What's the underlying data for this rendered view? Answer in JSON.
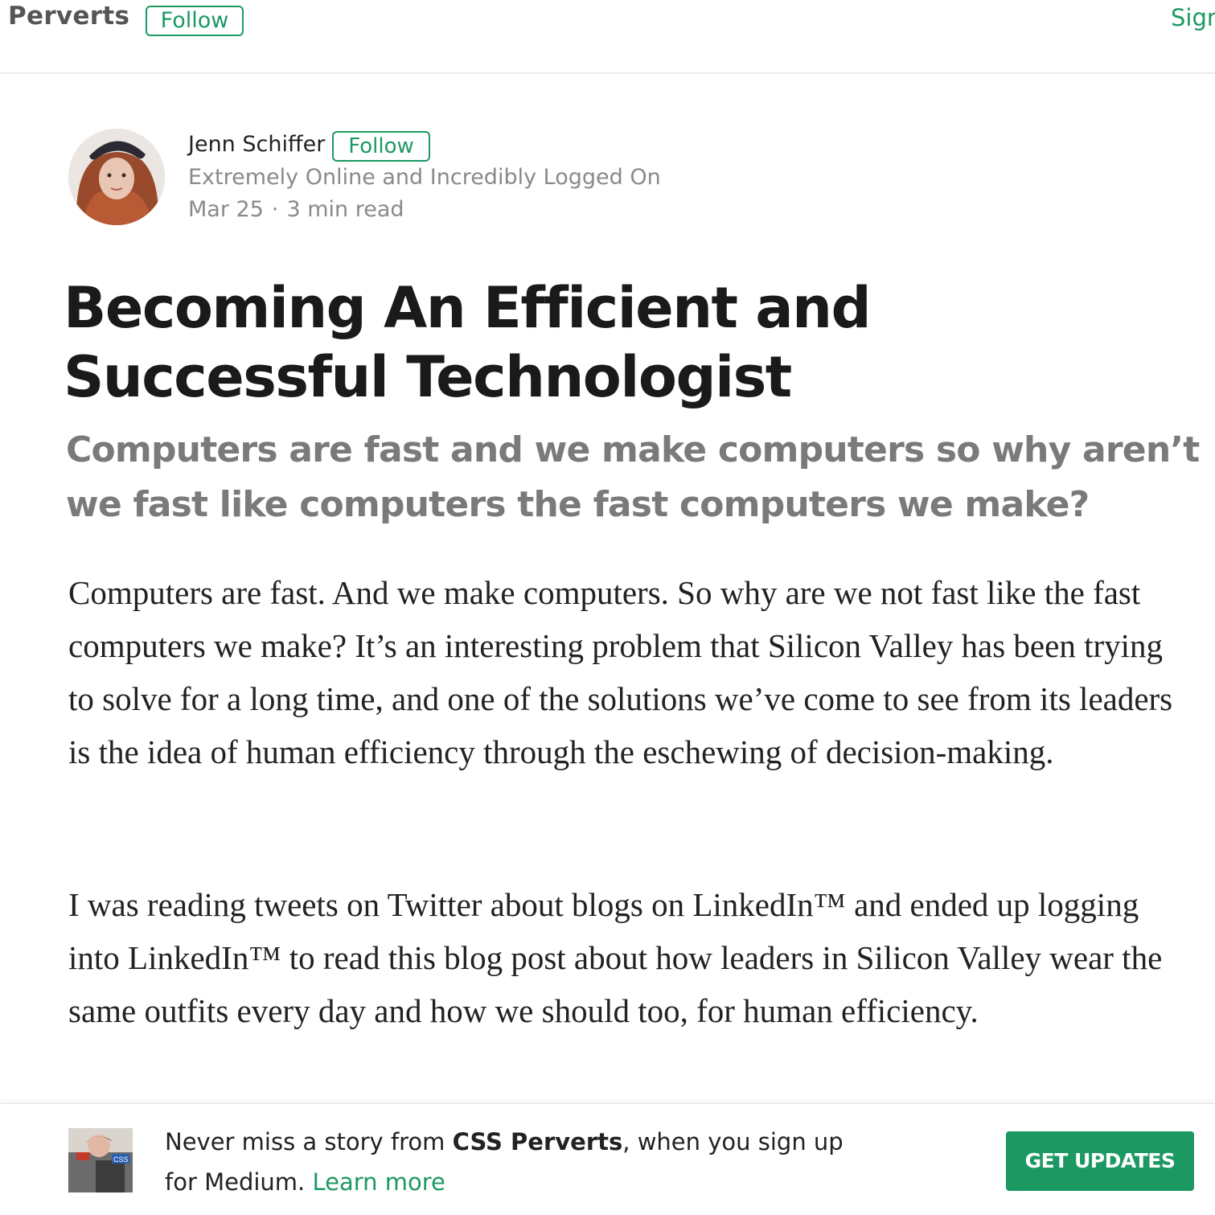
{
  "header": {
    "publication_name": "Perverts",
    "follow_label": "Follow",
    "sign_label": "Sign"
  },
  "author": {
    "name": "Jenn Schiffer",
    "follow_label": "Follow",
    "bio": "Extremely Online and Incredibly Logged On",
    "date": "Mar 25",
    "separator": "·",
    "read_time": "3 min read"
  },
  "article": {
    "title": "Becoming An Efficient and Successful Technologist",
    "subtitle": "Computers are fast and we make computers so why aren’t we fast like computers the fast computers we make?",
    "paragraphs": [
      "Computers are fast. And we make computers. So why are we not fast like the fast computers we make? It’s an interesting problem that Silicon Valley has been trying to solve for a long time, and one of the solutions we’ve come to see from its leaders is the idea of human efficiency through the eschewing of decision-making.",
      "I was reading tweets on Twitter about blogs on LinkedIn™ and ended up logging into LinkedIn™ to read this blog post about how leaders in Silicon Valley wear the same outfits every day and how we should too, for human efficiency."
    ]
  },
  "banner": {
    "text_before": "Never miss a story from ",
    "publication": "CSS Perverts",
    "text_after": ", when you sign up for Medium. ",
    "learn_more": "Learn more",
    "button_label": "GET UPDATES",
    "thumb_label": "CSS"
  },
  "colors": {
    "accent": "#1c9963",
    "title": "#1a1a1a",
    "muted": "#8a8a8a"
  }
}
